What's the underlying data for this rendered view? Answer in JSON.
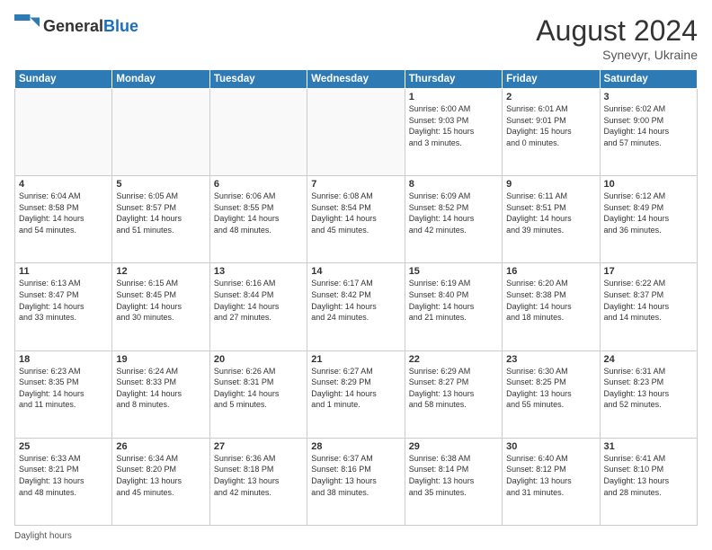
{
  "header": {
    "logo_general": "General",
    "logo_blue": "Blue",
    "month_year": "August 2024",
    "location": "Synevyr, Ukraine"
  },
  "footer": {
    "label": "Daylight hours"
  },
  "weekdays": [
    "Sunday",
    "Monday",
    "Tuesday",
    "Wednesday",
    "Thursday",
    "Friday",
    "Saturday"
  ],
  "weeks": [
    [
      {
        "day": "",
        "info": ""
      },
      {
        "day": "",
        "info": ""
      },
      {
        "day": "",
        "info": ""
      },
      {
        "day": "",
        "info": ""
      },
      {
        "day": "1",
        "info": "Sunrise: 6:00 AM\nSunset: 9:03 PM\nDaylight: 15 hours\nand 3 minutes."
      },
      {
        "day": "2",
        "info": "Sunrise: 6:01 AM\nSunset: 9:01 PM\nDaylight: 15 hours\nand 0 minutes."
      },
      {
        "day": "3",
        "info": "Sunrise: 6:02 AM\nSunset: 9:00 PM\nDaylight: 14 hours\nand 57 minutes."
      }
    ],
    [
      {
        "day": "4",
        "info": "Sunrise: 6:04 AM\nSunset: 8:58 PM\nDaylight: 14 hours\nand 54 minutes."
      },
      {
        "day": "5",
        "info": "Sunrise: 6:05 AM\nSunset: 8:57 PM\nDaylight: 14 hours\nand 51 minutes."
      },
      {
        "day": "6",
        "info": "Sunrise: 6:06 AM\nSunset: 8:55 PM\nDaylight: 14 hours\nand 48 minutes."
      },
      {
        "day": "7",
        "info": "Sunrise: 6:08 AM\nSunset: 8:54 PM\nDaylight: 14 hours\nand 45 minutes."
      },
      {
        "day": "8",
        "info": "Sunrise: 6:09 AM\nSunset: 8:52 PM\nDaylight: 14 hours\nand 42 minutes."
      },
      {
        "day": "9",
        "info": "Sunrise: 6:11 AM\nSunset: 8:51 PM\nDaylight: 14 hours\nand 39 minutes."
      },
      {
        "day": "10",
        "info": "Sunrise: 6:12 AM\nSunset: 8:49 PM\nDaylight: 14 hours\nand 36 minutes."
      }
    ],
    [
      {
        "day": "11",
        "info": "Sunrise: 6:13 AM\nSunset: 8:47 PM\nDaylight: 14 hours\nand 33 minutes."
      },
      {
        "day": "12",
        "info": "Sunrise: 6:15 AM\nSunset: 8:45 PM\nDaylight: 14 hours\nand 30 minutes."
      },
      {
        "day": "13",
        "info": "Sunrise: 6:16 AM\nSunset: 8:44 PM\nDaylight: 14 hours\nand 27 minutes."
      },
      {
        "day": "14",
        "info": "Sunrise: 6:17 AM\nSunset: 8:42 PM\nDaylight: 14 hours\nand 24 minutes."
      },
      {
        "day": "15",
        "info": "Sunrise: 6:19 AM\nSunset: 8:40 PM\nDaylight: 14 hours\nand 21 minutes."
      },
      {
        "day": "16",
        "info": "Sunrise: 6:20 AM\nSunset: 8:38 PM\nDaylight: 14 hours\nand 18 minutes."
      },
      {
        "day": "17",
        "info": "Sunrise: 6:22 AM\nSunset: 8:37 PM\nDaylight: 14 hours\nand 14 minutes."
      }
    ],
    [
      {
        "day": "18",
        "info": "Sunrise: 6:23 AM\nSunset: 8:35 PM\nDaylight: 14 hours\nand 11 minutes."
      },
      {
        "day": "19",
        "info": "Sunrise: 6:24 AM\nSunset: 8:33 PM\nDaylight: 14 hours\nand 8 minutes."
      },
      {
        "day": "20",
        "info": "Sunrise: 6:26 AM\nSunset: 8:31 PM\nDaylight: 14 hours\nand 5 minutes."
      },
      {
        "day": "21",
        "info": "Sunrise: 6:27 AM\nSunset: 8:29 PM\nDaylight: 14 hours\nand 1 minute."
      },
      {
        "day": "22",
        "info": "Sunrise: 6:29 AM\nSunset: 8:27 PM\nDaylight: 13 hours\nand 58 minutes."
      },
      {
        "day": "23",
        "info": "Sunrise: 6:30 AM\nSunset: 8:25 PM\nDaylight: 13 hours\nand 55 minutes."
      },
      {
        "day": "24",
        "info": "Sunrise: 6:31 AM\nSunset: 8:23 PM\nDaylight: 13 hours\nand 52 minutes."
      }
    ],
    [
      {
        "day": "25",
        "info": "Sunrise: 6:33 AM\nSunset: 8:21 PM\nDaylight: 13 hours\nand 48 minutes."
      },
      {
        "day": "26",
        "info": "Sunrise: 6:34 AM\nSunset: 8:20 PM\nDaylight: 13 hours\nand 45 minutes."
      },
      {
        "day": "27",
        "info": "Sunrise: 6:36 AM\nSunset: 8:18 PM\nDaylight: 13 hours\nand 42 minutes."
      },
      {
        "day": "28",
        "info": "Sunrise: 6:37 AM\nSunset: 8:16 PM\nDaylight: 13 hours\nand 38 minutes."
      },
      {
        "day": "29",
        "info": "Sunrise: 6:38 AM\nSunset: 8:14 PM\nDaylight: 13 hours\nand 35 minutes."
      },
      {
        "day": "30",
        "info": "Sunrise: 6:40 AM\nSunset: 8:12 PM\nDaylight: 13 hours\nand 31 minutes."
      },
      {
        "day": "31",
        "info": "Sunrise: 6:41 AM\nSunset: 8:10 PM\nDaylight: 13 hours\nand 28 minutes."
      }
    ]
  ]
}
